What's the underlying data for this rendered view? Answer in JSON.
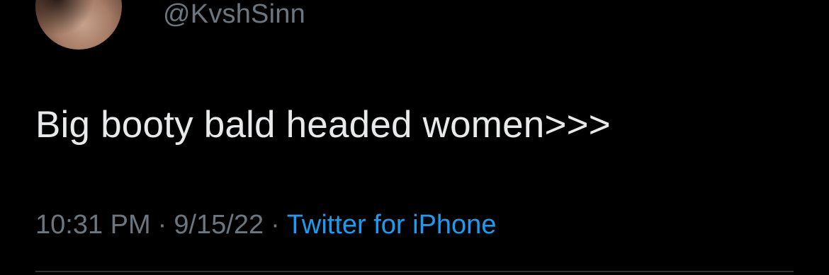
{
  "tweet": {
    "handle": "@KvshSinn",
    "text": "Big booty bald headed women>>>",
    "time": "10:31 PM",
    "separator": "·",
    "date": "9/15/22",
    "source": "Twitter for iPhone"
  },
  "colors": {
    "background": "#000000",
    "text": "#e7e9ea",
    "muted": "#6e767d",
    "link": "#1d9bf0",
    "divider": "#2f3336"
  }
}
